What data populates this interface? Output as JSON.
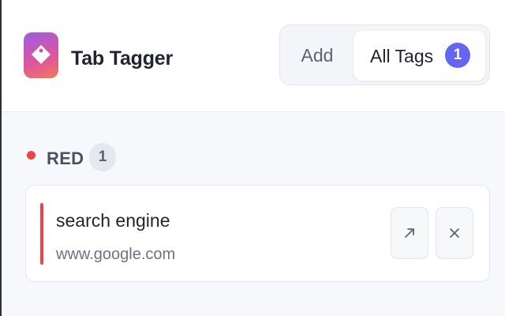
{
  "app": {
    "title": "Tab Tagger"
  },
  "tabs": [
    {
      "label": "Add",
      "active": false
    },
    {
      "label": "All Tags",
      "active": true,
      "count": "1"
    }
  ],
  "groups": [
    {
      "name": "RED",
      "color": "#ef4444",
      "count": "1",
      "items": [
        {
          "title": "search engine",
          "url": "www.google.com"
        }
      ]
    }
  ],
  "icons": {
    "logo": "tag-icon",
    "open": "arrow-up-right-icon",
    "remove": "close-icon"
  },
  "colors": {
    "accent": "#6466f1",
    "red": "#ef4444"
  }
}
